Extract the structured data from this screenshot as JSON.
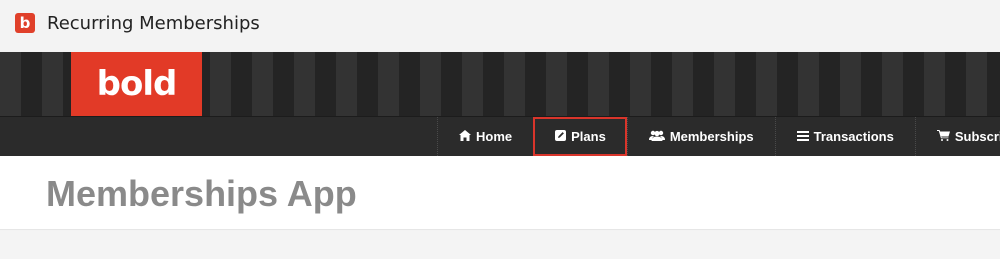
{
  "window": {
    "title": "Recurring Memberships",
    "app_icon_letter": "b"
  },
  "banner": {
    "logo_text": "bold",
    "brand_color": "#e23a27"
  },
  "nav": {
    "items": [
      {
        "label": "Home",
        "icon": "home-icon"
      },
      {
        "label": "Plans",
        "icon": "edit-icon"
      },
      {
        "label": "Memberships",
        "icon": "users-icon"
      },
      {
        "label": "Transactions",
        "icon": "list-icon"
      },
      {
        "label": "Subscription Or",
        "icon": "cart-icon"
      }
    ]
  },
  "page": {
    "title": "Memberships App"
  }
}
